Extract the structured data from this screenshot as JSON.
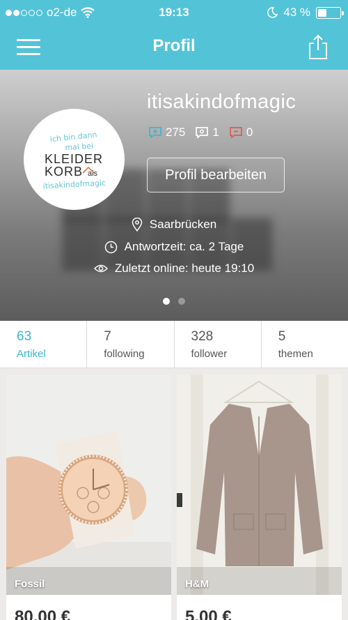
{
  "status_bar": {
    "carrier": "o2-de",
    "time": "19:13",
    "battery": "43 %",
    "battery_level": 0.43
  },
  "nav": {
    "title": "Profil"
  },
  "profile": {
    "username": "itisakindofmagic",
    "stats": [
      {
        "icon": "chat-plus-icon",
        "value": "275",
        "color": "#3bb5cf"
      },
      {
        "icon": "chat-neutral-icon",
        "value": "1",
        "color": "#ffffff"
      },
      {
        "icon": "chat-negative-icon",
        "value": "0",
        "color": "#e05a4e"
      }
    ],
    "edit_label": "Profil bearbeiten",
    "location": "Saarbrücken",
    "response_time": "Antwortzeit: ca. 2 Tage",
    "last_online": "Zuletzt online: heute 19:10",
    "avatar_logo": {
      "line1": "ich bin dann",
      "line2": "mal bei",
      "line3": "KLEIDER",
      "line4": "KORB",
      "line4b": "als",
      "line5": "itisakindofmagic"
    }
  },
  "tabs": [
    {
      "count": "63",
      "label": "Artikel"
    },
    {
      "count": "7",
      "label": "following"
    },
    {
      "count": "328",
      "label": "follower"
    },
    {
      "count": "5",
      "label": "themen"
    }
  ],
  "items": [
    {
      "brand": "Fossil",
      "price": "80,00 €"
    },
    {
      "brand": "H&M",
      "price": "5,00 €"
    }
  ],
  "colors": {
    "accent": "#53c3d8",
    "active_tab": "#3bb5cf"
  }
}
